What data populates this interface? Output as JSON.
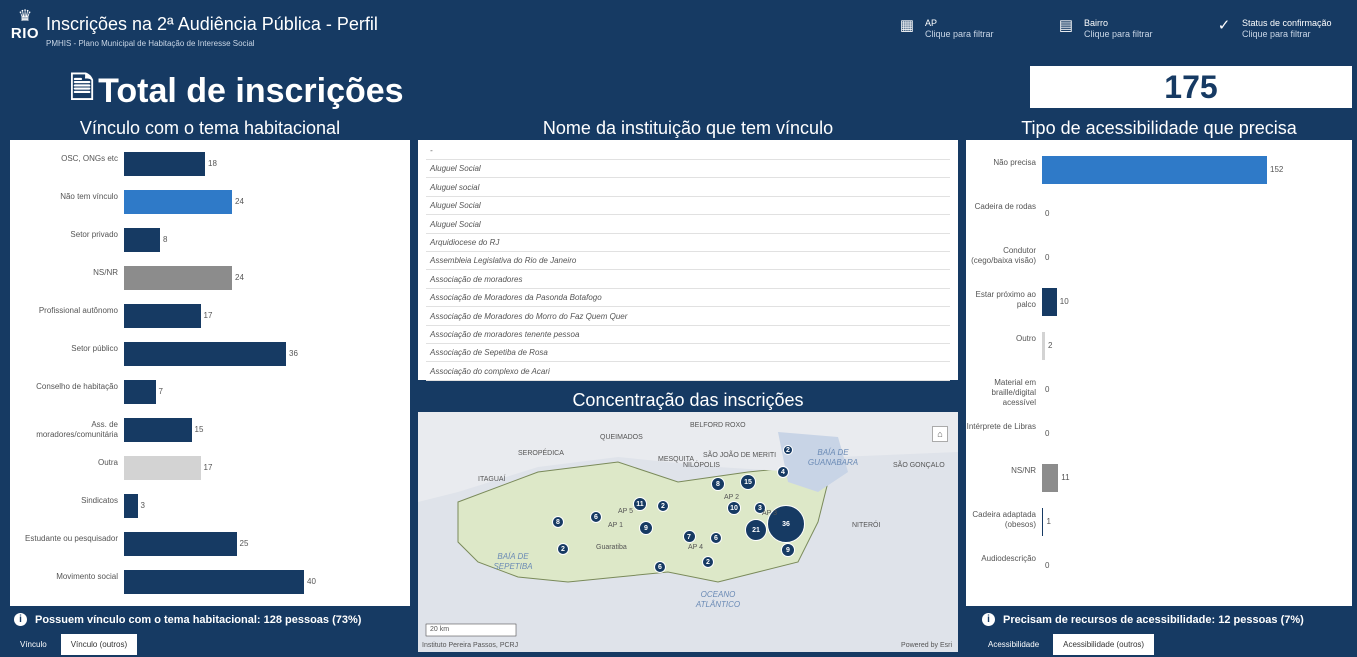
{
  "header": {
    "title": "Inscrições na 2ª Audiência Pública - Perfil",
    "subtitle": "PMHIS - Plano Municipal de Habitação de Interesse Social",
    "logo_text": "RIO",
    "filters": [
      {
        "name": "AP",
        "hint": "Clique para filtrar",
        "icon": "grid-icon"
      },
      {
        "name": "Bairro",
        "hint": "Clique para filtrar",
        "icon": "building-icon"
      },
      {
        "name": "Status de confirmação",
        "hint": "Clique para filtrar",
        "icon": "check-icon"
      }
    ]
  },
  "total": {
    "label": "Total de inscrições",
    "value": "175"
  },
  "vinculo": {
    "title": "Vínculo com o tema habitacional",
    "bars": [
      {
        "label": "OSC, ONGs etc",
        "value": 18,
        "value_text": "18",
        "color": "#163a63"
      },
      {
        "label": "Não tem vínculo",
        "value": 24,
        "value_text": "24",
        "color": "#2f7ac8"
      },
      {
        "label": "Setor privado",
        "value": 8,
        "value_text": "8",
        "color": "#163a63"
      },
      {
        "label": "NS/NR",
        "value": 24,
        "value_text": "24",
        "color": "#8c8c8c"
      },
      {
        "label": "Profissional autônomo",
        "value": 17,
        "value_text": "17",
        "color": "#163a63"
      },
      {
        "label": "Setor público",
        "value": 36,
        "value_text": "36",
        "color": "#163a63"
      },
      {
        "label": "Conselho de habitação",
        "value": 7,
        "value_text": "7",
        "color": "#163a63"
      },
      {
        "label": "Ass. de moradores/comunitária",
        "value": 15,
        "value_text": "15",
        "color": "#163a63"
      },
      {
        "label": "Outra",
        "value": 17,
        "value_text": "17",
        "color": "#d3d3d3"
      },
      {
        "label": "Sindicatos",
        "value": 3,
        "value_text": "3",
        "color": "#163a63"
      },
      {
        "label": "Estudante ou pesquisador",
        "value": 25,
        "value_text": "25",
        "color": "#163a63"
      },
      {
        "label": "Movimento social",
        "value": 40,
        "value_text": "40",
        "color": "#163a63"
      }
    ],
    "info": "Possuem vínculo com o tema habitacional: 128 pessoas (73%)",
    "tabs": [
      "Vínculo",
      "Vínculo (outros)"
    ]
  },
  "instituicao": {
    "title": "Nome da instituição que tem vínculo",
    "items": [
      "-",
      "Aluguel Social",
      "Aluguel social",
      "Aluguel Social",
      "Aluguel Social",
      "Arquidiocese do RJ",
      "Assembleia Legislativa do Rio de Janeiro",
      "Associação de moradores",
      "Associação de Moradores da Pasonda Botafogo",
      "Associação de Moradores do Morro do Faz Quem Quer",
      "Associação de moradores tenente pessoa",
      "Associação de Sepetiba de Rosa",
      "Associação do complexo de Acari"
    ]
  },
  "mapa": {
    "title": "Concentração das inscrições",
    "scale": "20 km",
    "attribution_left": "Instituto Pereira Passos, PCRJ",
    "attribution_right": "Powered by Esri",
    "water_labels": [
      "BAÍA DE SEPETIBA",
      "OCEANO ATLÂNTICO",
      "BAÍA DE GUANABARA"
    ],
    "place_labels": [
      "QUEIMADOS",
      "BELFORD ROXO",
      "SEROPÉDICA",
      "NILÓPOLIS",
      "ITAGUAÍ",
      "Guaratiba",
      "SÃO JOÃO DE MERITI",
      "MESQUITA",
      "NITERÓI",
      "SÃO GONÇALO",
      "AP 1",
      "AP 2",
      "AP 3",
      "AP 4",
      "AP 5"
    ],
    "bubbles": [
      {
        "label": "8"
      },
      {
        "label": "15"
      },
      {
        "label": "2"
      },
      {
        "label": "4"
      },
      {
        "label": "11"
      },
      {
        "label": "2"
      },
      {
        "label": "10"
      },
      {
        "label": "3"
      },
      {
        "label": "8"
      },
      {
        "label": "6"
      },
      {
        "label": "9"
      },
      {
        "label": "7"
      },
      {
        "label": "6"
      },
      {
        "label": "21"
      },
      {
        "label": "36"
      },
      {
        "label": "2"
      },
      {
        "label": "2"
      },
      {
        "label": "6"
      },
      {
        "label": "9"
      }
    ]
  },
  "acessibilidade": {
    "title": "Tipo de acessibilidade que precisa",
    "bars": [
      {
        "label": "Não precisa",
        "value": 152,
        "value_text": "152",
        "color": "#2f7ac8"
      },
      {
        "label": "Cadeira de rodas",
        "value": 0,
        "value_text": "0",
        "color": "#163a63"
      },
      {
        "label": "Condutor (cego/baixa visão)",
        "value": 0,
        "value_text": "0",
        "color": "#163a63"
      },
      {
        "label": "Estar próximo ao palco",
        "value": 10,
        "value_text": "10",
        "color": "#163a63"
      },
      {
        "label": "Outro",
        "value": 2,
        "value_text": "2",
        "color": "#d3d3d3"
      },
      {
        "label": "Material em braille/digital acessível",
        "value": 0,
        "value_text": "0",
        "color": "#163a63"
      },
      {
        "label": "Intérprete de Libras",
        "value": 0,
        "value_text": "0",
        "color": "#163a63"
      },
      {
        "label": "NS/NR",
        "value": 11,
        "value_text": "11",
        "color": "#8c8c8c"
      },
      {
        "label": "Cadeira adaptada (obesos)",
        "value": 1,
        "value_text": "1",
        "color": "#163a63"
      },
      {
        "label": "Audiodescrição",
        "value": 0,
        "value_text": "0",
        "color": "#163a63"
      }
    ],
    "info": "Precisam de recursos de acessibilidade: 12 pessoas (7%)",
    "tabs": [
      "Acessibilidade",
      "Acessibilidade (outros)"
    ]
  }
}
